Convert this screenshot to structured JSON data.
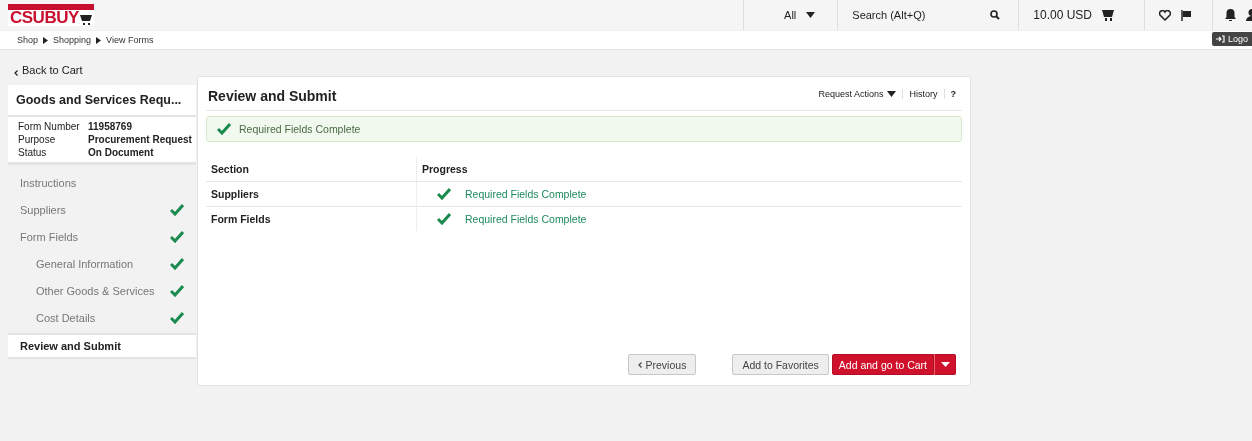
{
  "header": {
    "logo": "CSUBUY",
    "search_scope": "All",
    "search": {
      "placeholder": "Search (Alt+Q)"
    },
    "cart_total": "10.00 USD",
    "logout": "Logo"
  },
  "breadcrumb": [
    "Shop",
    "Shopping",
    "View Forms"
  ],
  "back_link": "Back to Cart",
  "form": {
    "title": "Goods and Services Requ...",
    "fields": [
      {
        "label": "Form Number",
        "value": "11958769"
      },
      {
        "label": "Purpose",
        "value": "Procurement Request"
      },
      {
        "label": "Status",
        "value": "On Document"
      }
    ]
  },
  "sidebar": {
    "items": [
      {
        "label": "Instructions",
        "complete": false,
        "selected": false
      },
      {
        "label": "Suppliers",
        "complete": true,
        "selected": false
      },
      {
        "label": "Form Fields",
        "complete": true,
        "selected": false,
        "children": [
          {
            "label": "General Information",
            "complete": true,
            "selected": false
          },
          {
            "label": "Other Goods & Services",
            "complete": true,
            "selected": false
          },
          {
            "label": "Cost Details",
            "complete": true,
            "selected": false
          }
        ]
      },
      {
        "label": "Review and Submit",
        "complete": false,
        "selected": true
      }
    ]
  },
  "panel": {
    "title": "Review and Submit",
    "actions": [
      "Request Actions",
      "History",
      "?"
    ],
    "alert": "Required Fields Complete",
    "table": {
      "columns": [
        "Section",
        "Progress"
      ],
      "rows": [
        {
          "section": "Suppliers",
          "progress": "Required Fields Complete",
          "complete": true
        },
        {
          "section": "Form Fields",
          "progress": "Required Fields Complete",
          "complete": true
        }
      ]
    },
    "buttons": {
      "previous": "Previous",
      "favorites": "Add to Favorites",
      "primary": "Add and go to Cart"
    }
  }
}
